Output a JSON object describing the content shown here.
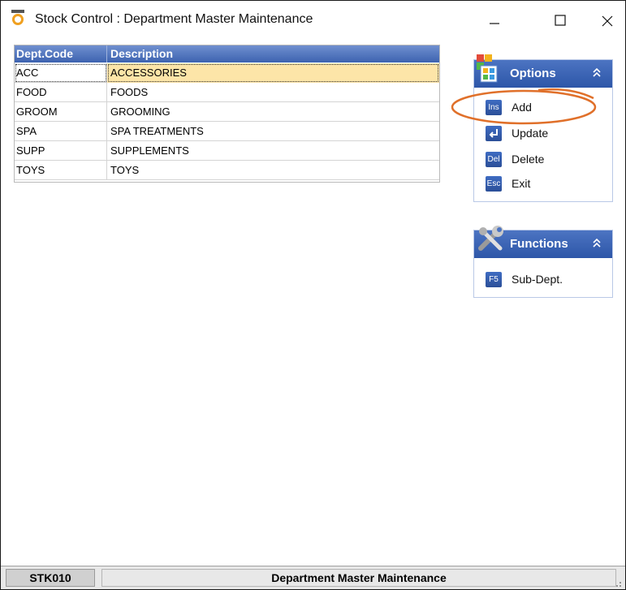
{
  "window": {
    "title": "Stock Control : Department Master Maintenance",
    "buttons": [
      "minimize",
      "maximize",
      "close"
    ]
  },
  "grid": {
    "columns": [
      "Dept.Code",
      "Description"
    ],
    "rows": [
      {
        "code": "ACC",
        "description": "ACCESSORIES",
        "selected": true
      },
      {
        "code": "FOOD",
        "description": "FOODS"
      },
      {
        "code": "GROOM",
        "description": "GROOMING"
      },
      {
        "code": "SPA",
        "description": "SPA TREATMENTS"
      },
      {
        "code": "SUPP",
        "description": "SUPPLEMENTS"
      },
      {
        "code": "TOYS",
        "description": "TOYS"
      }
    ]
  },
  "options_panel": {
    "title": "Options",
    "icon": "options-grid-icon",
    "items": [
      {
        "key": "Ins",
        "label": "Add"
      },
      {
        "key": "enter",
        "label": "Update"
      },
      {
        "key": "Del",
        "label": "Delete"
      },
      {
        "key": "Esc",
        "label": "Exit"
      }
    ]
  },
  "functions_panel": {
    "title": "Functions",
    "icon": "tools-icon",
    "items": [
      {
        "key": "F5",
        "label": "Sub-Dept."
      }
    ]
  },
  "status": {
    "code": "STK010",
    "title": "Department Master Maintenance"
  },
  "colors": {
    "header_blue": "#3d63b0",
    "selected_row": "#fde5a8",
    "annotation": "#e0702a"
  }
}
